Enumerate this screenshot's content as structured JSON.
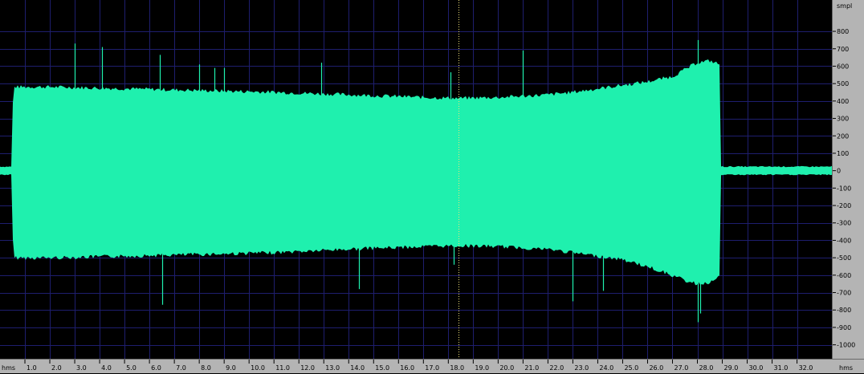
{
  "rulers": {
    "x_unit_left": "hms",
    "x_unit_right": "hms",
    "y_unit": "smpl",
    "x_tick_labels": [
      "1.0",
      "2.0",
      "3.0",
      "4.0",
      "5.0",
      "6.0",
      "7.0",
      "8.0",
      "9.0",
      "10.0",
      "11.0",
      "12.0",
      "13.0",
      "14.0",
      "15.0",
      "16.0",
      "17.0",
      "18.0",
      "19.0",
      "20.0",
      "21.0",
      "22.0",
      "23.0",
      "24.0",
      "25.0",
      "26.0",
      "27.0",
      "28.0",
      "29.0",
      "30.0",
      "31.0",
      "32.0"
    ],
    "y_tick_labels": [
      "800",
      "700",
      "600",
      "500",
      "400",
      "300",
      "200",
      "100",
      "0",
      "-100",
      "-200",
      "-300",
      "-400",
      "-500",
      "-600",
      "-700",
      "-800",
      "-900",
      "-1000"
    ]
  },
  "colors": {
    "background": "#000000",
    "waveform": "#1ff0ae",
    "grid": "#1e1e6e",
    "cursor": "#f2e27a",
    "ruler": "#b4b4b4"
  },
  "chart_data": {
    "type": "area",
    "x_unit": "seconds",
    "y_unit": "samples",
    "cursor_time": 18.4,
    "xlim": [
      0,
      33.4
    ],
    "ylim": [
      -1080,
      980
    ],
    "upper_envelope": [
      [
        0.0,
        20
      ],
      [
        0.5,
        20
      ],
      [
        0.52,
        470
      ],
      [
        2,
        470
      ],
      [
        5,
        460
      ],
      [
        8,
        450
      ],
      [
        11,
        440
      ],
      [
        14,
        425
      ],
      [
        17,
        410
      ],
      [
        18.4,
        405
      ],
      [
        20,
        410
      ],
      [
        22,
        425
      ],
      [
        23,
        440
      ],
      [
        24,
        460
      ],
      [
        25,
        480
      ],
      [
        26,
        500
      ],
      [
        27,
        530
      ],
      [
        27.5,
        570
      ],
      [
        28,
        610
      ],
      [
        28.5,
        620
      ],
      [
        28.9,
        600
      ],
      [
        28.92,
        20
      ],
      [
        33.4,
        20
      ]
    ],
    "lower_envelope": [
      [
        0.0,
        -20
      ],
      [
        0.5,
        -20
      ],
      [
        0.52,
        -490
      ],
      [
        2,
        -490
      ],
      [
        5,
        -480
      ],
      [
        8,
        -470
      ],
      [
        11,
        -460
      ],
      [
        14,
        -440
      ],
      [
        17,
        -425
      ],
      [
        18.4,
        -420
      ],
      [
        20,
        -425
      ],
      [
        22,
        -440
      ],
      [
        23,
        -460
      ],
      [
        24,
        -480
      ],
      [
        25,
        -500
      ],
      [
        26,
        -540
      ],
      [
        27,
        -590
      ],
      [
        27.5,
        -620
      ],
      [
        28,
        -640
      ],
      [
        28.5,
        -630
      ],
      [
        28.9,
        -600
      ],
      [
        28.92,
        -20
      ],
      [
        33.4,
        -20
      ]
    ],
    "peaks": [
      [
        3.0,
        730
      ],
      [
        4.1,
        710
      ],
      [
        6.4,
        665
      ],
      [
        8.0,
        610
      ],
      [
        8.6,
        590
      ],
      [
        9.0,
        590
      ],
      [
        12.9,
        620
      ],
      [
        18.1,
        565
      ],
      [
        21.0,
        690
      ],
      [
        28.0,
        750
      ],
      [
        6.5,
        -770
      ],
      [
        14.4,
        -680
      ],
      [
        18.2,
        -540
      ],
      [
        23.0,
        -750
      ],
      [
        24.2,
        -690
      ],
      [
        28.0,
        -870
      ],
      [
        28.1,
        -820
      ]
    ]
  }
}
